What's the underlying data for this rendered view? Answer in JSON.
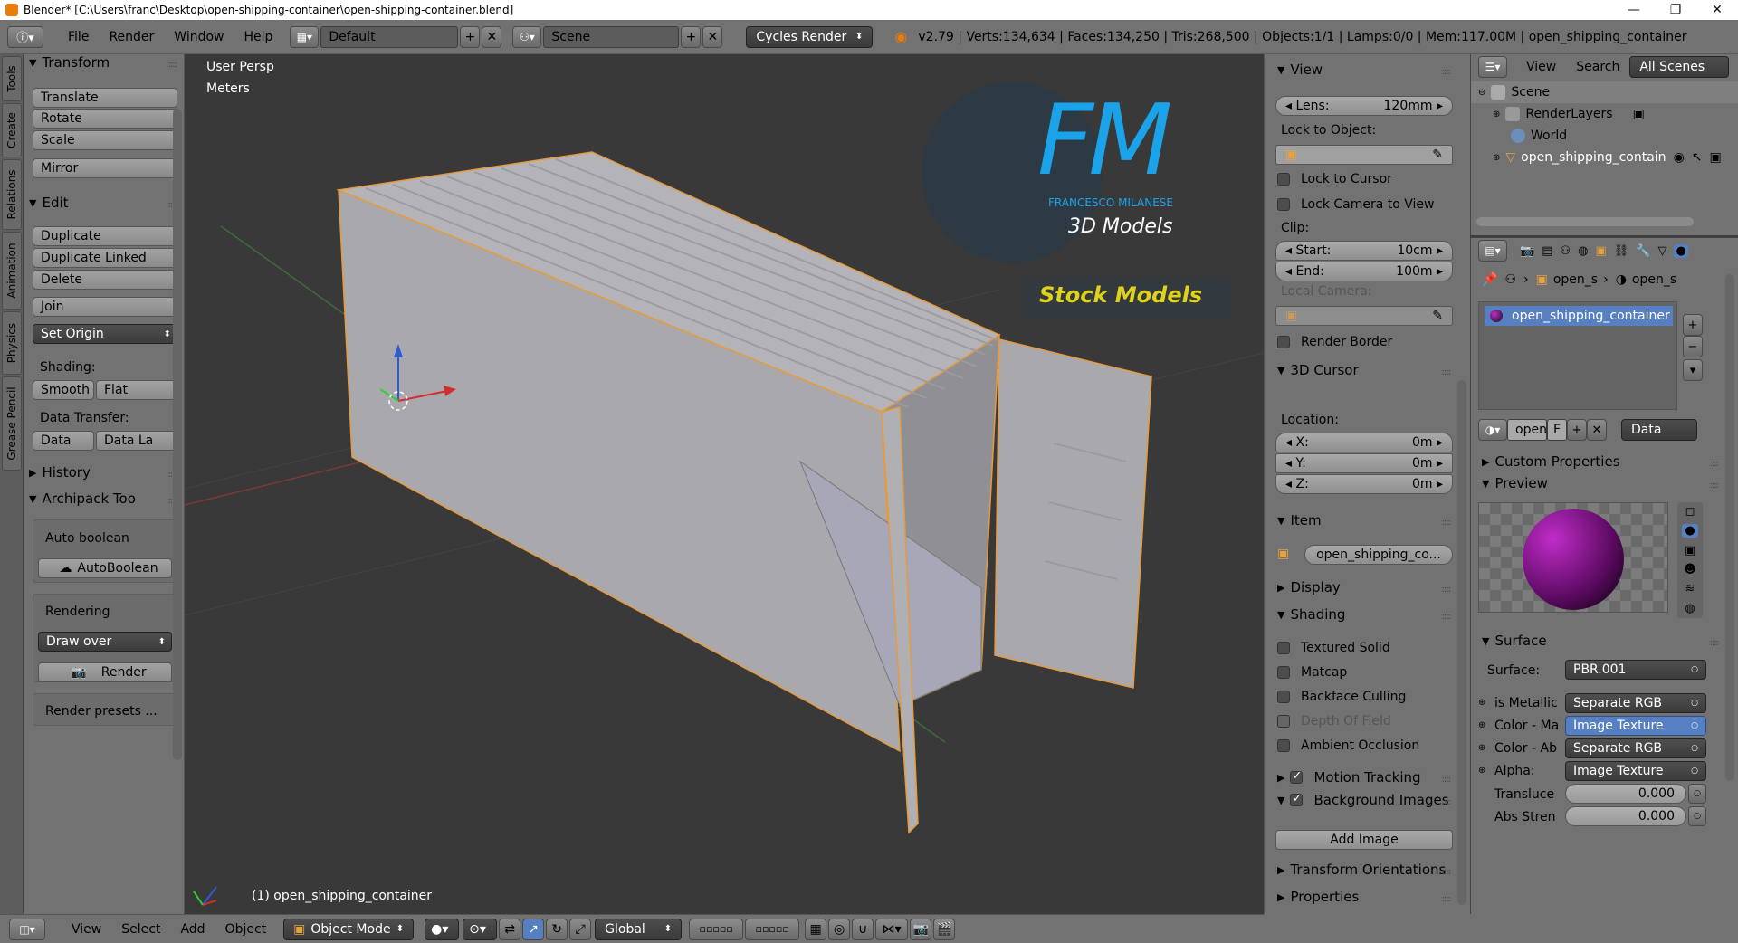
{
  "window": {
    "title": "Blender* [C:\\Users\\franc\\Desktop\\open-shipping-container\\open-shipping-container.blend]",
    "minimize": "—",
    "maximize": "❐",
    "close": "✕"
  },
  "infobar": {
    "menus": [
      "File",
      "Render",
      "Window",
      "Help"
    ],
    "layout": "Default",
    "scene": "Scene",
    "engine": "Cycles Render",
    "stats": "v2.79 | Verts:134,634 | Faces:134,250 | Tris:268,500 | Objects:1/1 | Lamps:0/0 | Mem:117.00M | open_shipping_container"
  },
  "tabs": [
    "Tools",
    "Create",
    "Relations",
    "Animation",
    "Physics",
    "Grease Pencil"
  ],
  "toolshelf": {
    "transform": {
      "title": "Transform",
      "buttons": [
        "Translate",
        "Rotate",
        "Scale",
        "Mirror"
      ]
    },
    "edit": {
      "title": "Edit",
      "buttons": [
        "Duplicate",
        "Duplicate Linked",
        "Delete",
        "Join"
      ],
      "set_origin": "Set Origin"
    },
    "shading": {
      "label": "Shading:",
      "smooth": "Smooth",
      "flat": "Flat"
    },
    "data_transfer": {
      "label": "Data Transfer:",
      "data": "Data",
      "data_la": "Data La"
    },
    "history": "History",
    "archipack": {
      "title": "Archipack Too",
      "auto_boolean": "Auto boolean",
      "auto_boolean_btn": "AutoBoolean",
      "rendering": "Rendering",
      "draw_over": "Draw over",
      "render": "Render",
      "render_presets": "Render presets ..."
    }
  },
  "viewport": {
    "view_name": "User Persp",
    "units": "Meters",
    "object_label": "(1) open_shipping_container",
    "logo": {
      "letters": "FM",
      "name": "FRANCESCO MILANESE",
      "sub": "3D Models",
      "badge": "Stock Models"
    }
  },
  "npanel": {
    "view": {
      "title": "View",
      "lens_label": "Lens:",
      "lens_value": "120mm",
      "lock_to_object": "Lock to Object:",
      "lock_to_cursor": "Lock to Cursor",
      "lock_camera": "Lock Camera to View",
      "clip": "Clip:",
      "start_label": "Start:",
      "start_value": "10cm",
      "end_label": "End:",
      "end_value": "100m",
      "local_camera": "Local Camera:",
      "render_border": "Render Border"
    },
    "cursor": {
      "title": "3D Cursor",
      "location": "Location:",
      "x_label": "X:",
      "x": "0m",
      "y_label": "Y:",
      "y": "0m",
      "z_label": "Z:",
      "z": "0m"
    },
    "item": {
      "title": "Item",
      "name": "open_shipping_co..."
    },
    "display": "Display",
    "shading": {
      "title": "Shading",
      "options": [
        "Textured Solid",
        "Matcap",
        "Backface Culling",
        "Depth Of Field",
        "Ambient Occlusion"
      ]
    },
    "motion_tracking": "Motion Tracking",
    "background_images": "Background Images",
    "add_image": "Add Image",
    "transform_orientations": "Transform Orientations",
    "properties": "Properties"
  },
  "outliner": {
    "view": "View",
    "search": "Search",
    "filter": "All Scenes",
    "items": [
      {
        "label": "Scene"
      },
      {
        "label": "RenderLayers"
      },
      {
        "label": "World"
      },
      {
        "label": "open_shipping_contain"
      }
    ]
  },
  "props": {
    "breadcrumb": [
      "open_s",
      "open_s"
    ],
    "material_slot": "open_shipping_container",
    "mat_name": "open",
    "f_label": "F",
    "data_dropdown": "Data",
    "custom_properties": "Custom Properties",
    "preview": "Preview",
    "surface": {
      "title": "Surface",
      "surface_label": "Surface:",
      "surface_value": "PBR.001",
      "rows": [
        {
          "label": "is Metallic",
          "value": "Separate RGB",
          "highlight": false
        },
        {
          "label": "Color - Ma",
          "value": "Image Texture",
          "highlight": true
        },
        {
          "label": "Color - Ab",
          "value": "Separate RGB",
          "highlight": false
        },
        {
          "label": "Alpha:",
          "value": "Image Texture",
          "highlight": false
        }
      ],
      "translucent_label": "Transluce",
      "translucent_value": "0.000",
      "abs_label": "Abs Stren",
      "abs_value": "0.000"
    }
  },
  "bottombar": {
    "menus": [
      "View",
      "Select",
      "Add",
      "Object"
    ],
    "mode": "Object Mode",
    "orientation": "Global"
  },
  "colors": {
    "accent_blue": "#5680c2",
    "orange": "#e87d0d",
    "logo_blue": "#1aa3e8",
    "logo_yellow": "#e0d21a"
  }
}
